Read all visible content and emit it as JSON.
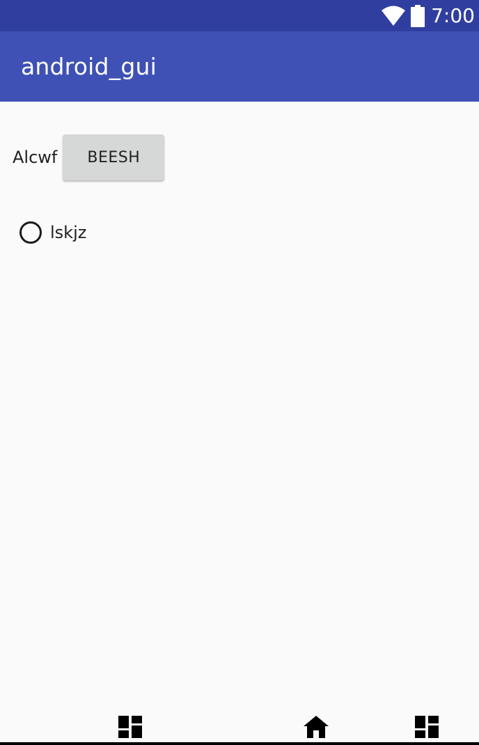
{
  "status_bar": {
    "time": "7:00",
    "icons": [
      "wifi-icon",
      "battery-icon"
    ],
    "color": "#303f9f"
  },
  "app_bar": {
    "title": "android_gui",
    "color": "#3f51b5"
  },
  "content": {
    "label": "Alcwf",
    "button_label": "BEESH",
    "radio": {
      "label": "lskjz",
      "checked": false
    }
  },
  "nav_bar": {
    "icons": [
      "dashboard-icon",
      "home-icon",
      "dashboard-icon"
    ]
  }
}
